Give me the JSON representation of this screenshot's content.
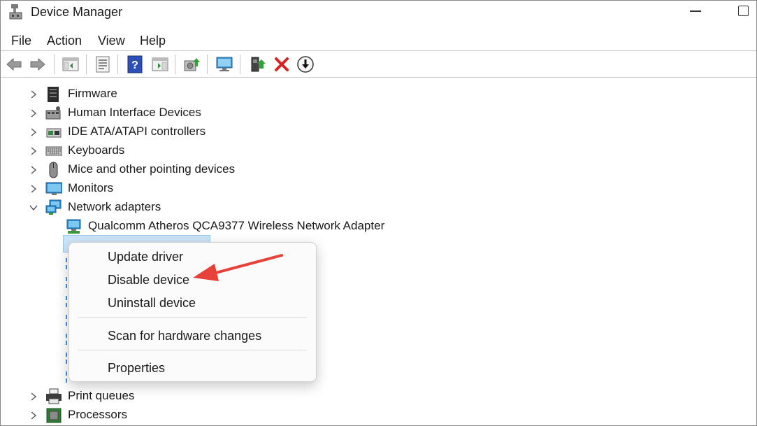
{
  "window": {
    "title": "Device Manager"
  },
  "menu": {
    "items": [
      "File",
      "Action",
      "View",
      "Help"
    ]
  },
  "toolbar": {
    "buttons": [
      "back-arrow",
      "forward-arrow",
      "show-hide-console-tree",
      "properties",
      "help",
      "show-action-pane",
      "update-driver",
      "scan-hardware",
      "monitor",
      "enable-device",
      "uninstall-device",
      "disable-device"
    ]
  },
  "tree": {
    "items": [
      {
        "label": "Firmware",
        "icon": "firmware-icon",
        "state": "collapsed"
      },
      {
        "label": "Human Interface Devices",
        "icon": "hid-icon",
        "state": "collapsed"
      },
      {
        "label": "IDE ATA/ATAPI controllers",
        "icon": "ide-controller-icon",
        "state": "collapsed"
      },
      {
        "label": "Keyboards",
        "icon": "keyboard-icon",
        "state": "collapsed"
      },
      {
        "label": "Mice and other pointing devices",
        "icon": "mouse-icon",
        "state": "collapsed"
      },
      {
        "label": "Monitors",
        "icon": "monitor-icon",
        "state": "collapsed"
      },
      {
        "label": "Network adapters",
        "icon": "network-icon",
        "state": "expanded"
      }
    ],
    "network_children": [
      {
        "label": "Qualcomm Atheros QCA9377 Wireless Network Adapter",
        "icon": "network-adapter-icon"
      }
    ],
    "bottom_items": [
      {
        "label": "Print queues",
        "icon": "printer-icon",
        "state": "collapsed"
      },
      {
        "label": "Processors",
        "icon": "processor-icon",
        "state": "collapsed"
      }
    ]
  },
  "context_menu": {
    "update_driver": "Update driver",
    "disable_device": "Disable device",
    "uninstall_device": "Uninstall device",
    "scan_hardware": "Scan for hardware changes",
    "properties": "Properties"
  },
  "colors": {
    "arrow": "#e8413a",
    "selection": "#cce4f7",
    "accent": "#1f7ad6"
  }
}
